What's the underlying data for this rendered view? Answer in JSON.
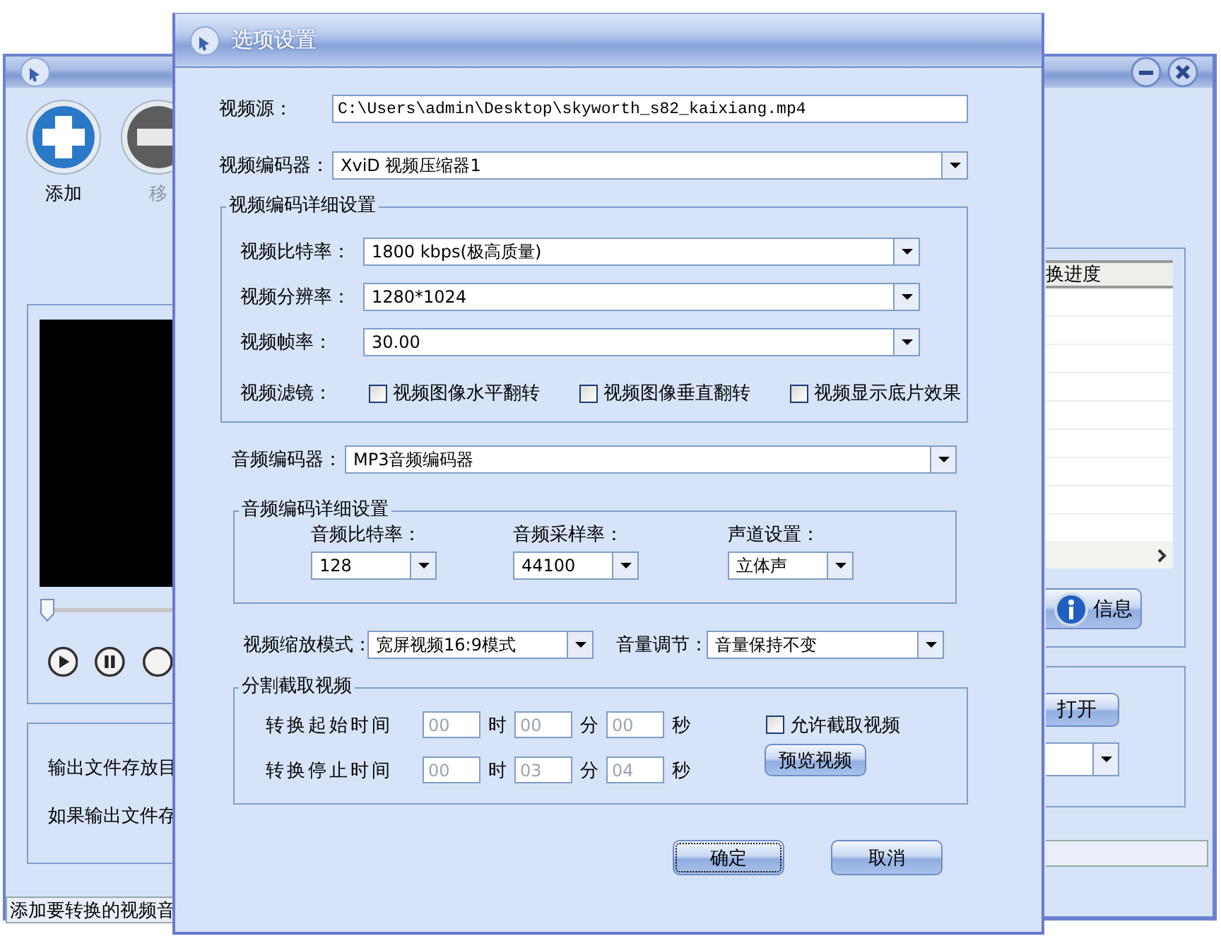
{
  "background_window": {
    "toolbar": [
      {
        "kind": "add",
        "label": "添加",
        "disabled": false
      },
      {
        "kind": "remove",
        "label": "移",
        "disabled": true
      }
    ],
    "seek": {
      "level": 0
    },
    "list_header": "换进度",
    "info_button": "信息",
    "output_labels": [
      "输出文件存放目",
      "如果输出文件存"
    ],
    "open_button": "打开",
    "status_bar": "添加要转换的视频音"
  },
  "dialog": {
    "title": "选项设置",
    "video_source": {
      "label": "视频源：",
      "value": "C:\\Users\\admin\\Desktop\\skyworth_s82_kaixiang.mp4"
    },
    "video_encoder": {
      "label": "视频编码器：",
      "value": "XviD 视频压缩器1"
    },
    "video_details": {
      "title": "视频编码详细设置",
      "rows": [
        {
          "label": "视频比特率：",
          "value": "1800 kbps(极高质量)"
        },
        {
          "label": "视频分辨率：",
          "value": "1280*1024"
        },
        {
          "label": "视频帧率：",
          "value": "30.00"
        }
      ],
      "filter_label": "视频滤镜：",
      "filters": [
        {
          "label": "视频图像水平翻转",
          "checked": false
        },
        {
          "label": "视频图像垂直翻转",
          "checked": false
        },
        {
          "label": "视频显示底片效果",
          "checked": false
        }
      ]
    },
    "audio_encoder": {
      "label": "音频编码器：",
      "value": "MP3音频编码器"
    },
    "audio_details": {
      "title": "音频编码详细设置",
      "columns": [
        {
          "label": "音频比特率：",
          "value": "128"
        },
        {
          "label": "音频采样率：",
          "value": "44100"
        },
        {
          "label": "声道设置：",
          "value": "立体声"
        }
      ]
    },
    "scale_mode": {
      "label": "视频缩放模式：",
      "value": "宽屏视频16:9模式"
    },
    "volume": {
      "label": "音量调节：",
      "value": "音量保持不变"
    },
    "split": {
      "title": "分割截取视频",
      "rows": [
        {
          "label": "转换起始时间",
          "fields": [
            {
              "value": "00",
              "unit": "时",
              "disabled": true
            },
            {
              "value": "00",
              "unit": "分",
              "disabled": true
            },
            {
              "value": "00",
              "unit": "秒",
              "disabled": true
            }
          ]
        },
        {
          "label": "转换停止时间",
          "fields": [
            {
              "value": "00",
              "unit": "时",
              "disabled": true
            },
            {
              "value": "03",
              "unit": "分",
              "disabled": true
            },
            {
              "value": "04",
              "unit": "秒",
              "disabled": true
            }
          ]
        }
      ],
      "allow": {
        "label": "允许截取视频",
        "checked": false
      },
      "preview_button": "预览视频"
    },
    "buttons": [
      {
        "label": "确定",
        "focused": true
      },
      {
        "label": "取消",
        "focused": false
      }
    ]
  }
}
